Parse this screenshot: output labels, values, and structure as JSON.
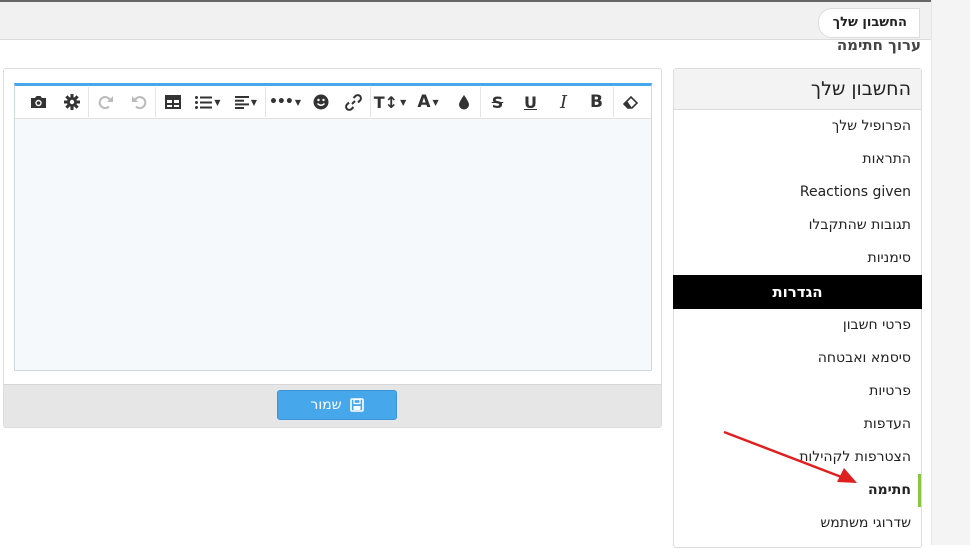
{
  "breadcrumb": {
    "label": "החשבון שלך"
  },
  "page_title": "ערוך חתימה",
  "sidebar": {
    "title": "החשבון שלך",
    "items": [
      "הפרופיל שלך",
      "התראות",
      "Reactions given",
      "תגובות שהתקבלו",
      "סימניות"
    ],
    "section": "הגדרות",
    "settings_items": [
      "פרטי חשבון",
      "סיסמא ואבטחה",
      "פרטיות",
      "העדפות",
      "הצטרפות לקהילות",
      "חתימה",
      "שדרוגי משתמש"
    ],
    "active_item": "חתימה"
  },
  "toolbar": {
    "icons": [
      "eraser-icon",
      "bold-icon",
      "italic-icon",
      "underline-icon",
      "strikethrough-icon",
      "color-icon",
      "font-family-icon",
      "font-size-icon",
      "link-icon",
      "smiley-icon",
      "more-icon",
      "align-icon",
      "list-icon",
      "table-icon",
      "undo-icon",
      "redo-icon",
      "settings-icon",
      "camera-icon"
    ],
    "bold": "B",
    "italic": "I",
    "underline": "U",
    "strike": "S",
    "font": "A",
    "size": "T↕"
  },
  "save_button": {
    "label": "שמור"
  },
  "colors": {
    "accent": "#47a7eb",
    "active_marker": "#8cc63f",
    "arrow": "#e02020",
    "section_bg": "#000000"
  }
}
